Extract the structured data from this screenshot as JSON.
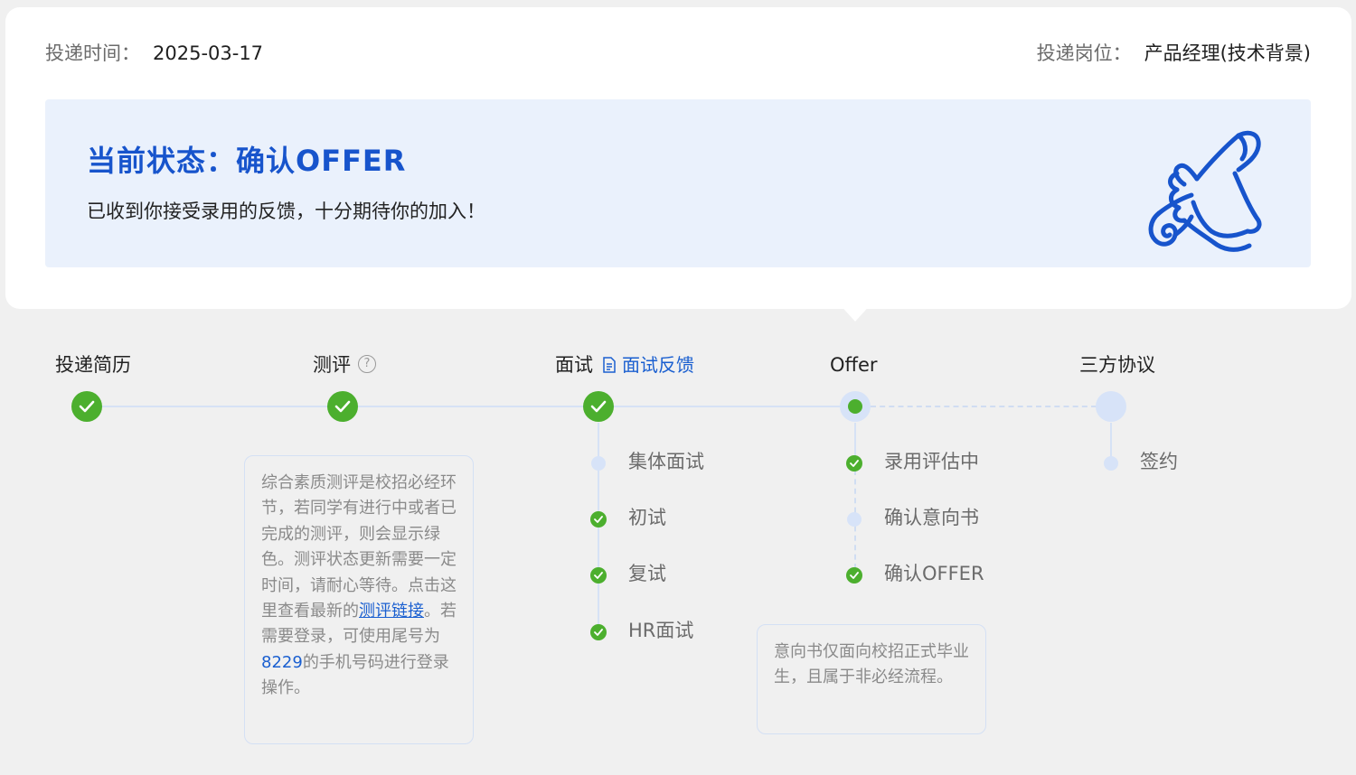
{
  "header": {
    "submit_time_label": "投递时间：",
    "submit_time_value": "2025-03-17",
    "position_label": "投递岗位：",
    "position_value": "产品经理(技术背景)"
  },
  "status": {
    "title": "当前状态：确认OFFER",
    "description": "已收到你接受录用的反馈，十分期待你的加入！",
    "icon": "scroll-hand-icon"
  },
  "steps": [
    {
      "label": "投递简历",
      "state": "done"
    },
    {
      "label": "测评",
      "state": "done",
      "icon": "help-icon"
    },
    {
      "label": "面试",
      "state": "done",
      "link": "面试反馈",
      "link_icon": "document-icon"
    },
    {
      "label": "Offer",
      "state": "current"
    },
    {
      "label": "三方协议",
      "state": "pending"
    }
  ],
  "interview_substeps": [
    {
      "label": "集体面试",
      "state": "pending"
    },
    {
      "label": "初试",
      "state": "done"
    },
    {
      "label": "复试",
      "state": "done"
    },
    {
      "label": "HR面试",
      "state": "done"
    }
  ],
  "offer_substeps": [
    {
      "label": "录用评估中",
      "state": "done"
    },
    {
      "label": "确认意向书",
      "state": "pending"
    },
    {
      "label": "确认OFFER",
      "state": "done"
    }
  ],
  "agreement_substeps": [
    {
      "label": "签约",
      "state": "pending"
    }
  ],
  "assessment_note": {
    "text_before_link": "综合素质测评是校招必经环节，若同学有进行中或者已完成的测评，则会显示绿色。测评状态更新需要一定时间，请耐心等待。点击这里查看最新的",
    "link_text": "测评链接",
    "text_after_link": "。若需要登录，可使用尾号为",
    "phone_suffix": "8229",
    "text_end": "的手机号码进行登录操作。"
  },
  "offer_note": {
    "text": "意向书仅面向校招正式毕业生，且属于非必经流程。"
  },
  "colors": {
    "accent": "#1754cc",
    "success": "#4caf2e",
    "pending": "#d7e3f8",
    "panel": "#eaf1fc"
  }
}
